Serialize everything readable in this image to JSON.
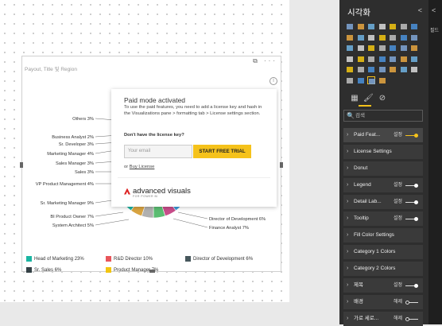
{
  "visual": {
    "title": "Payout, Title 및 Region",
    "icons": "⧉ ···",
    "info": "i"
  },
  "chart_data": {
    "type": "pie",
    "donut_labels": [
      "Others 3%",
      "Business Analyst 2%",
      "Sr. Developer 3%",
      "Marketing Manager 4%",
      "Sales Manager 3%",
      "Sales 3%",
      "VP Product Management 4%",
      "Sr. Marketing Manager 9%",
      "BI Product Owner 7%",
      "System Architect 5%",
      "Director of Development 6%",
      "Finance Analyst 7%"
    ],
    "legend": [
      {
        "name": "Head of Marketing 23%",
        "color": "#1ab5a2"
      },
      {
        "name": "R&D Director 10%",
        "color": "#e8555a"
      },
      {
        "name": "Director of Development 6%",
        "color": "#46575c"
      },
      {
        "name": "Sr. Sales 6%",
        "color": "#344146"
      },
      {
        "name": "Product Manager 7%",
        "color": "#f2c511"
      }
    ]
  },
  "popup": {
    "title": "Paid mode activated",
    "body": "To use the paid features, you need to add a license key and hash in the Visualizations pane > formatting tab > License settings section.",
    "question": "Don't have the license key?",
    "email_placeholder": "Your email",
    "trial_button": "START FREE TRIAL",
    "or": "or",
    "buy_link": "Buy License",
    "brand": "advanced visuals",
    "brand_sub": "FOR POWER BI"
  },
  "pane": {
    "title": "시각화",
    "collapse": "<",
    "fields_collapse": "<",
    "fields_label": "필드",
    "search_placeholder": "검색",
    "search_icon": "🔍",
    "properties": [
      {
        "label": "Paid Feat...",
        "state": "설정",
        "toggle": "yellow"
      },
      {
        "label": "License Settings",
        "state": "",
        "toggle": ""
      },
      {
        "label": "Donut",
        "state": "",
        "toggle": ""
      },
      {
        "label": "Legend",
        "state": "설정",
        "toggle": "on"
      },
      {
        "label": "Detail Lab...",
        "state": "설정",
        "toggle": "on"
      },
      {
        "label": "Tooltip",
        "state": "설정",
        "toggle": "on"
      },
      {
        "label": "Fill Color Settings",
        "state": "",
        "toggle": ""
      },
      {
        "label": "Category 1 Colors",
        "state": "",
        "toggle": ""
      },
      {
        "label": "Category 2 Colors",
        "state": "",
        "toggle": ""
      },
      {
        "label": "제목",
        "state": "설정",
        "toggle": "on"
      },
      {
        "label": "배경",
        "state": "해제",
        "toggle": "off"
      },
      {
        "label": "가로 세로...",
        "state": "해제",
        "toggle": "off"
      }
    ]
  }
}
